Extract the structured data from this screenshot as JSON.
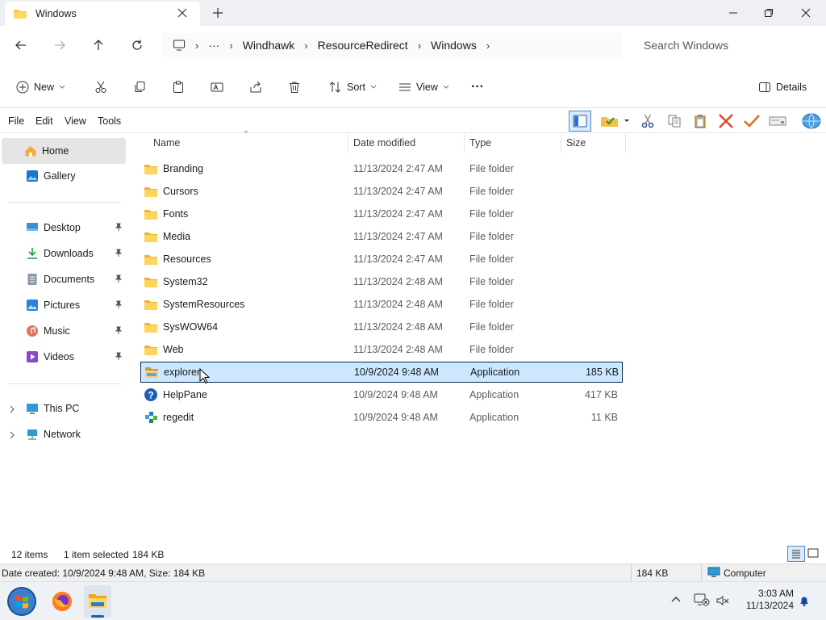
{
  "window": {
    "tab_title": "Windows"
  },
  "nav": {
    "breadcrumbs": [
      "Windhawk",
      "ResourceRedirect",
      "Windows"
    ],
    "ellipsis": "···",
    "search_placeholder": "Search Windows"
  },
  "commands": {
    "new": "New",
    "sort": "Sort",
    "view": "View",
    "more": "···",
    "details": "Details"
  },
  "menu": {
    "file": "File",
    "edit": "Edit",
    "view": "View",
    "tools": "Tools"
  },
  "sidebar": {
    "home": "Home",
    "gallery": "Gallery",
    "quick": [
      {
        "label": "Desktop",
        "icon": "desktop-icon"
      },
      {
        "label": "Downloads",
        "icon": "downloads-icon"
      },
      {
        "label": "Documents",
        "icon": "documents-icon"
      },
      {
        "label": "Pictures",
        "icon": "pictures-icon"
      },
      {
        "label": "Music",
        "icon": "music-icon"
      },
      {
        "label": "Videos",
        "icon": "videos-icon"
      }
    ],
    "this_pc": "This PC",
    "network": "Network"
  },
  "columns": {
    "name": "Name",
    "date": "Date modified",
    "type": "Type",
    "size": "Size"
  },
  "files": [
    {
      "name": "Branding",
      "date": "11/13/2024 2:47 AM",
      "type": "File folder",
      "size": "",
      "icon": "folder-icon"
    },
    {
      "name": "Cursors",
      "date": "11/13/2024 2:47 AM",
      "type": "File folder",
      "size": "",
      "icon": "folder-icon"
    },
    {
      "name": "Fonts",
      "date": "11/13/2024 2:47 AM",
      "type": "File folder",
      "size": "",
      "icon": "folder-icon"
    },
    {
      "name": "Media",
      "date": "11/13/2024 2:47 AM",
      "type": "File folder",
      "size": "",
      "icon": "folder-icon"
    },
    {
      "name": "Resources",
      "date": "11/13/2024 2:47 AM",
      "type": "File folder",
      "size": "",
      "icon": "folder-icon"
    },
    {
      "name": "System32",
      "date": "11/13/2024 2:48 AM",
      "type": "File folder",
      "size": "",
      "icon": "folder-icon"
    },
    {
      "name": "SystemResources",
      "date": "11/13/2024 2:48 AM",
      "type": "File folder",
      "size": "",
      "icon": "folder-icon"
    },
    {
      "name": "SysWOW64",
      "date": "11/13/2024 2:48 AM",
      "type": "File folder",
      "size": "",
      "icon": "folder-icon"
    },
    {
      "name": "Web",
      "date": "11/13/2024 2:48 AM",
      "type": "File folder",
      "size": "",
      "icon": "folder-icon"
    },
    {
      "name": "explorer",
      "date": "10/9/2024 9:48 AM",
      "type": "Application",
      "size": "185 KB",
      "icon": "explorer-app-icon",
      "selected": true
    },
    {
      "name": "HelpPane",
      "date": "10/9/2024 9:48 AM",
      "type": "Application",
      "size": "417 KB",
      "icon": "help-icon"
    },
    {
      "name": "regedit",
      "date": "10/9/2024 9:48 AM",
      "type": "Application",
      "size": "11 KB",
      "icon": "regedit-icon"
    }
  ],
  "status": {
    "count": "12 items",
    "selected": "1 item selected",
    "selected_size": "184 KB",
    "details": "Date created: 10/9/2024 9:48 AM, Size: 184 KB",
    "size_cell": "184 KB",
    "zone": "Computer"
  },
  "taskbar": {
    "time": "3:03 AM",
    "date": "11/13/2024"
  },
  "colors": {
    "selection": "#cce8ff",
    "folder": "#f6c445",
    "accent": "#0067c0"
  }
}
